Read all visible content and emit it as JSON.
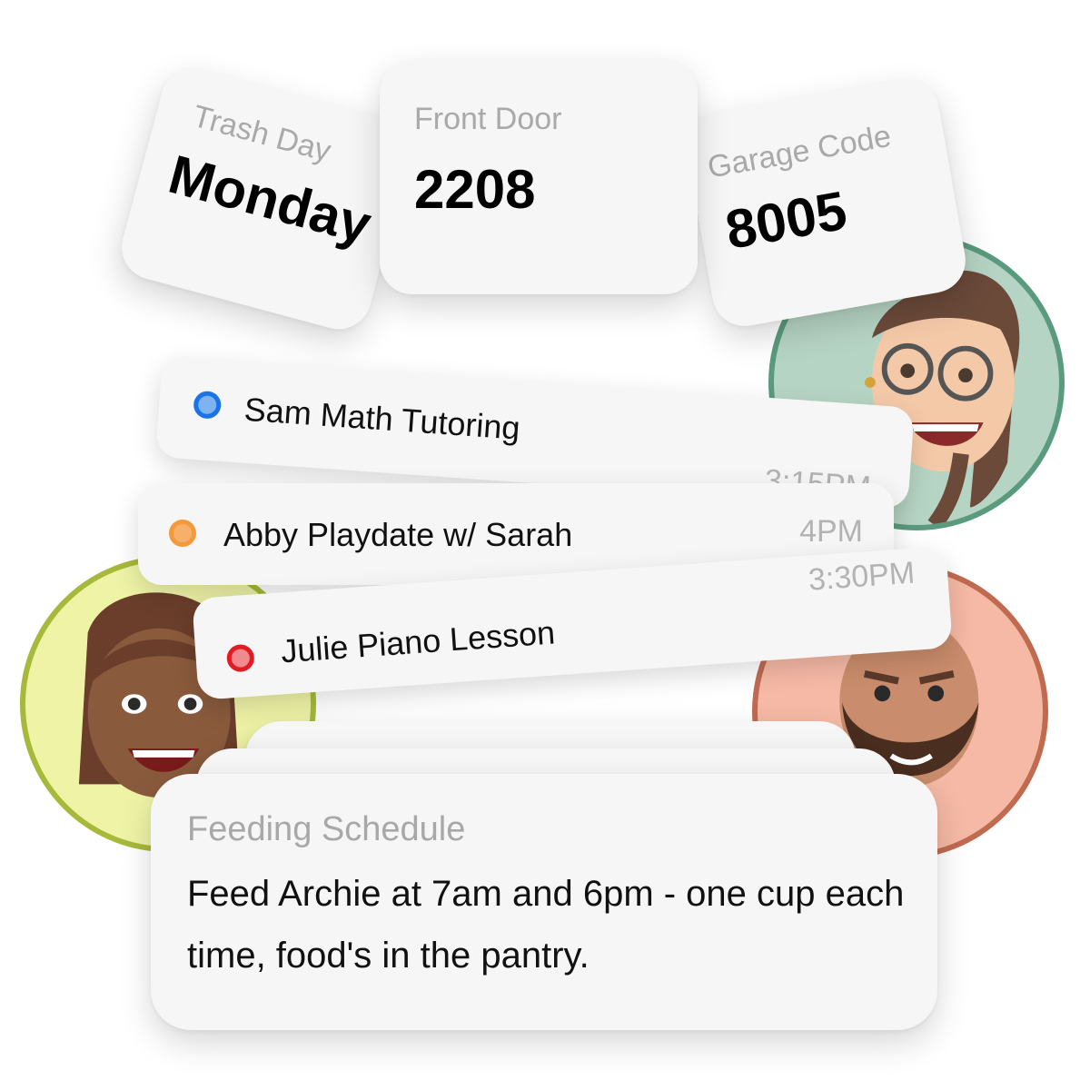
{
  "info_cards": [
    {
      "label": "Trash Day",
      "value": "Monday"
    },
    {
      "label": "Front Door",
      "value": "2208"
    },
    {
      "label": "Garage Code",
      "value": "8005"
    }
  ],
  "events": [
    {
      "title": "Sam Math Tutoring",
      "time": "3:15PM",
      "color": "#1a73e8",
      "fill": "#7fb2f0"
    },
    {
      "title": "Abby Playdate w/ Sarah",
      "time": "4PM",
      "color": "#f39a3c",
      "fill": "#f7b06c"
    },
    {
      "title": "Julie Piano Lesson",
      "time": "3:30PM",
      "color": "#e31b23",
      "fill": "#f08a8e"
    }
  ],
  "note": {
    "title": "Feeding Schedule",
    "body": "Feed Archie at 7am and 6pm - one cup each time, food's in the pantry."
  },
  "avatars": [
    {
      "icon": "memoji-woman-glasses-icon",
      "ring": "#5a9a7d",
      "bg": "#b6d4c4"
    },
    {
      "icon": "memoji-woman-icon",
      "ring": "#a6b93a",
      "bg": "#eef3a6"
    },
    {
      "icon": "memoji-bearded-man-icon",
      "ring": "#c06a50",
      "bg": "#f5b9a5"
    }
  ]
}
